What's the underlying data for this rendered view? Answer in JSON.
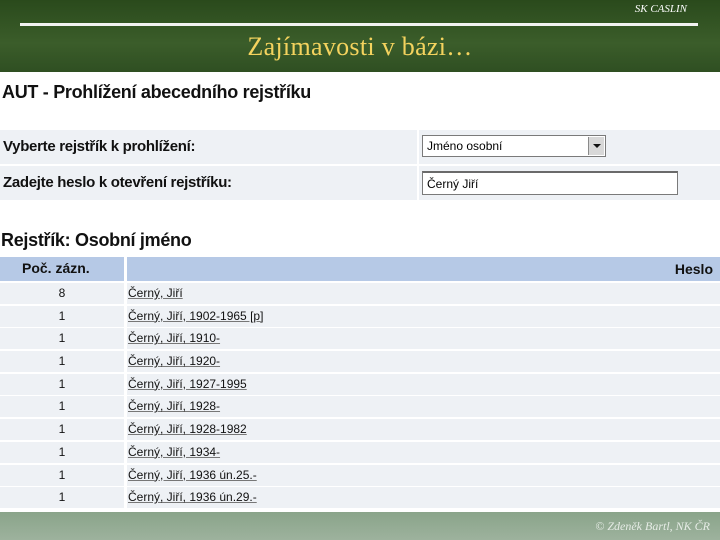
{
  "slide": {
    "org": "SK CASLIN",
    "title": "Zajímavosti v bázi…",
    "footer": "© Zdeněk Bartl, NK ČR"
  },
  "page": {
    "title": "AUT - Prohlížení abecedního rejstříku"
  },
  "form": {
    "index_label": "Vyberte rejstřík k prohlížení:",
    "index_value": "Jméno osobní",
    "term_label": "Zadejte heslo k otevření rejstříku:",
    "term_value": "Černý Jiří"
  },
  "results": {
    "title": "Rejstřík:  Osobní jméno",
    "col_count": "Poč. zázn.",
    "col_heading": "Heslo",
    "rows": [
      {
        "count": "8",
        "heading": "Černý, Jiří"
      },
      {
        "count": "1",
        "heading": "Černý, Jiří, 1902-1965 [p]"
      },
      {
        "count": "1",
        "heading": "Černý, Jiří, 1910-"
      },
      {
        "count": "1",
        "heading": "Černý, Jiří, 1920-"
      },
      {
        "count": "1",
        "heading": "Černý, Jiří, 1927-1995"
      },
      {
        "count": "1",
        "heading": "Černý, Jiří, 1928-"
      },
      {
        "count": "1",
        "heading": "Černý, Jiří, 1928-1982"
      },
      {
        "count": "1",
        "heading": "Černý, Jiří, 1934-"
      },
      {
        "count": "1",
        "heading": "Černý, Jiří, 1936 ún.25.-"
      },
      {
        "count": "1",
        "heading": "Černý, Jiří, 1936 ún.29.-"
      }
    ]
  },
  "colors": {
    "header_bg": "#3b5d2a",
    "title_color": "#f4d35e",
    "table_header": "#b6c9e6",
    "row_bg": "#eef1f5"
  }
}
